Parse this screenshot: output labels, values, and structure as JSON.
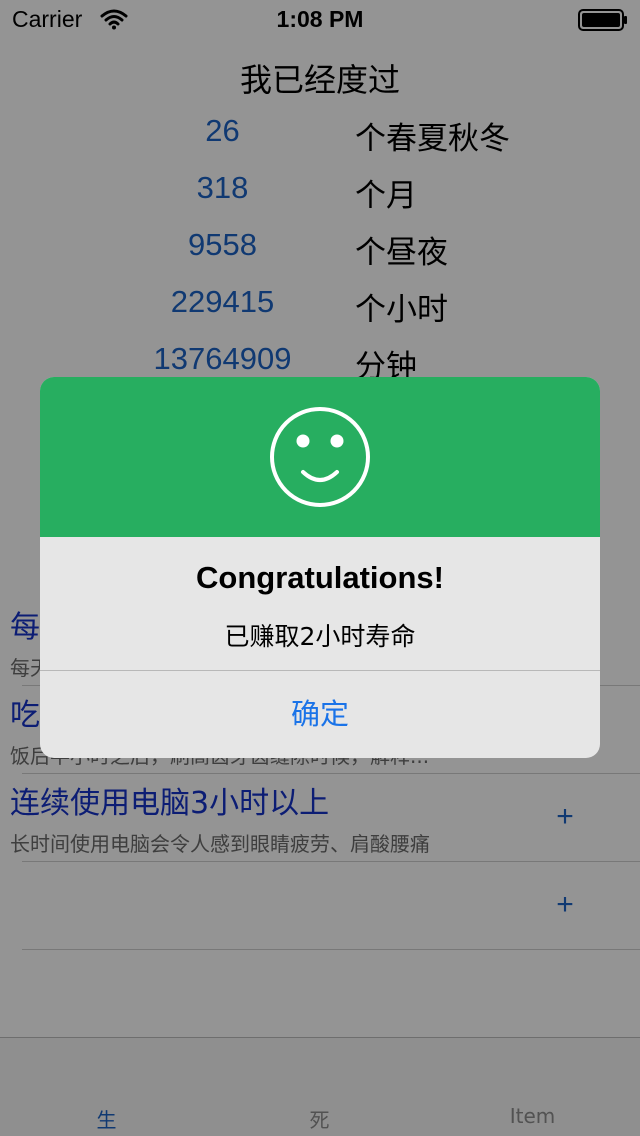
{
  "status_bar": {
    "carrier": "Carrier",
    "time": "1:08 PM"
  },
  "stats": {
    "title": "我已经度过",
    "rows": [
      {
        "value": "26",
        "unit": "个春夏秋冬"
      },
      {
        "value": "318",
        "unit": "个月"
      },
      {
        "value": "9558",
        "unit": "个昼夜"
      },
      {
        "value": "229415",
        "unit": "个小时"
      },
      {
        "value": "13764909",
        "unit": "分钟"
      }
    ]
  },
  "tasks": [
    {
      "title": "每",
      "desc": "每天",
      "add": "+"
    },
    {
      "title": "吃",
      "desc": "饭后半小时之后，刷高齿牙齿缝隙时候，解释...",
      "add": "+"
    },
    {
      "title": "连续使用电脑3小时以上",
      "desc": "长时间使用电脑会令人感到眼睛疲劳、肩酸腰痛",
      "add": "+"
    },
    {
      "title": "",
      "desc": "",
      "add": "+"
    }
  ],
  "tab_bar": {
    "tabs": [
      {
        "label": "生",
        "active": true
      },
      {
        "label": "死",
        "active": false
      },
      {
        "label": "Item",
        "active": false
      }
    ]
  },
  "alert": {
    "icon": "smile-icon",
    "title": "Congratulations!",
    "message": "已赚取2小时寿命",
    "button_label": "确定",
    "header_color": "#27ae60"
  },
  "colors": {
    "accent": "#1d62c4",
    "task_title": "#1532c9",
    "success": "#27ae60"
  }
}
